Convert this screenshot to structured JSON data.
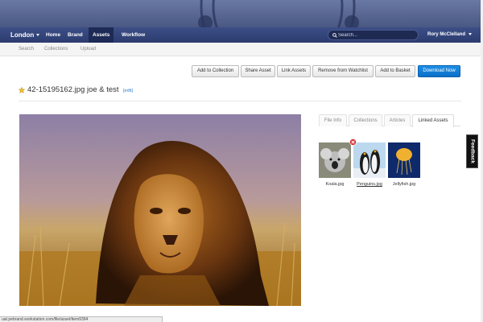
{
  "nav": {
    "brand": "London",
    "items": [
      "Home",
      "Brand",
      "Assets",
      "Workflow"
    ],
    "search_placeholder": "Search...",
    "user": "Rory McClelland"
  },
  "subnav": {
    "items": [
      "Search",
      "Collections",
      "Upload"
    ]
  },
  "toolbar": {
    "add_to_collection": "Add to Collection",
    "share_asset": "Share Asset",
    "link_assets": "Link Assets",
    "remove_from_watchlist": "Remove from Watchlist",
    "add_to_basket": "Add to Basket",
    "download_now": "Download Now"
  },
  "asset": {
    "title": "42-15195162.jpg joe & test",
    "edit": "[edit]"
  },
  "tabs": [
    "File Info",
    "Collections",
    "Articles",
    "Linked Assets"
  ],
  "linked_assets": [
    {
      "name": "Koala.jpg"
    },
    {
      "name": "Penguins.jpg"
    },
    {
      "name": "Jellyfish.jpg"
    }
  ],
  "feedback": "Feedback",
  "status_url": "uat.pebrand.workstation.com/file/asset/item9394",
  "colors": {
    "primary": "#0c6fc7",
    "nav": "#2c3c70",
    "star": "#e8b000",
    "remove": "#d62a2a"
  }
}
